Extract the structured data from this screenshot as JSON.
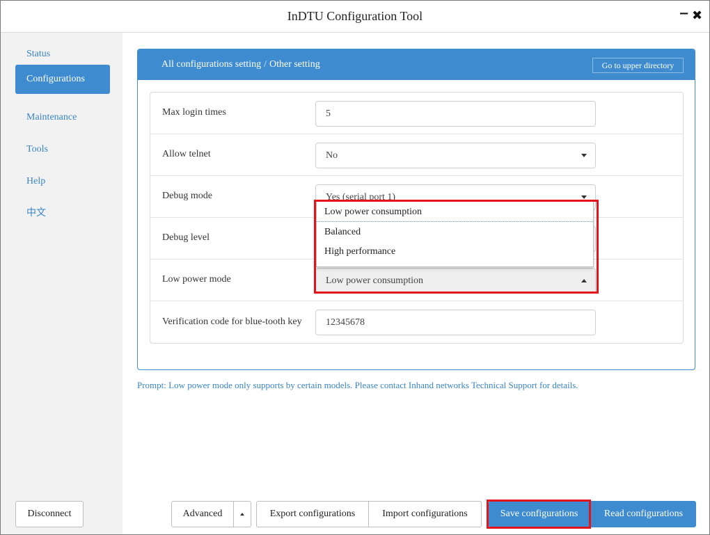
{
  "window": {
    "title": "InDTU Configuration Tool",
    "minimize_icon": "minimize-icon",
    "close_icon": "close-icon",
    "minimize_glyph": "−",
    "close_glyph": "✖"
  },
  "sidebar": {
    "items": [
      {
        "label": "Status",
        "active": false
      },
      {
        "label": "Configurations",
        "active": true
      },
      {
        "label": "Maintenance",
        "active": false
      },
      {
        "label": "Tools",
        "active": false
      },
      {
        "label": "Help",
        "active": false
      },
      {
        "label": "中文",
        "active": false
      }
    ],
    "disconnect_label": "Disconnect"
  },
  "panel": {
    "breadcrumb": [
      "All configurations setting",
      "Other setting"
    ],
    "breadcrumb_separator": "/",
    "upper_button_label": "Go to upper directory"
  },
  "form": {
    "rows": [
      {
        "label": "Max login times",
        "type": "input",
        "value": "5"
      },
      {
        "label": "Allow telnet",
        "type": "select",
        "value": "No"
      },
      {
        "label": "Debug mode",
        "type": "select",
        "value": "Yes (serial port 1)"
      },
      {
        "label": "Debug level",
        "type": "select",
        "value": ""
      },
      {
        "label": "Low power mode",
        "type": "select",
        "value": "Low power consumption"
      },
      {
        "label": "Verification code for blue-tooth key",
        "type": "input",
        "value": "12345678"
      }
    ]
  },
  "dropdown": {
    "options": [
      "Low power consumption",
      "Balanced",
      "High performance"
    ],
    "selected": "Low power consumption"
  },
  "prompt": "Prompt: Low power mode only supports by certain models. Please contact Inhand networks Technical Support for details.",
  "bottom_bar": {
    "advanced_label": "Advanced",
    "export_label": "Export configurations",
    "import_label": "Import configurations",
    "save_label": "Save configurations",
    "read_label": "Read configurations"
  },
  "colors": {
    "accent": "#3f8bd0",
    "highlight": "#e3141c",
    "link": "#3a85c6"
  }
}
